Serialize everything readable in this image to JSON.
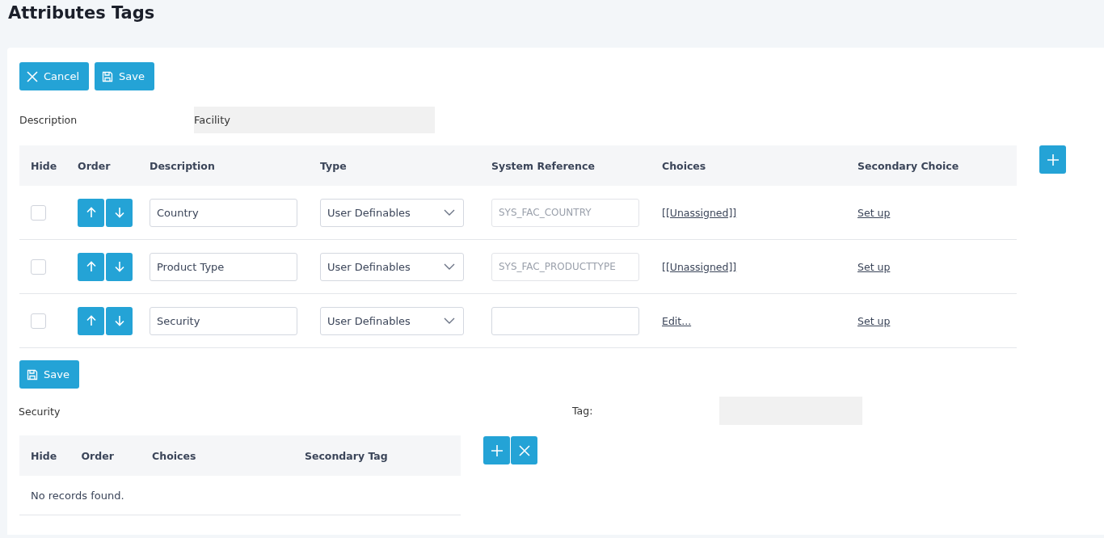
{
  "page_title": "Attributes Tags",
  "toolbar": {
    "cancel": "Cancel",
    "save": "Save"
  },
  "description": {
    "label": "Description",
    "value": "Facility"
  },
  "table": {
    "columns": [
      "Hide",
      "Order",
      "Description",
      "Type",
      "System Reference",
      "Choices",
      "Secondary Choice"
    ],
    "rows": [
      {
        "hide": false,
        "description": "Country",
        "type": "User Definables",
        "system_reference": "SYS_FAC_COUNTRY",
        "system_reference_disabled": true,
        "choices": "[[Unassigned]]",
        "secondary_choice": "Set up"
      },
      {
        "hide": false,
        "description": "Product Type",
        "type": "User Definables",
        "system_reference": "SYS_FAC_PRODUCTTYPE",
        "system_reference_disabled": true,
        "choices": "[[Unassigned]]",
        "secondary_choice": "Set up"
      },
      {
        "hide": false,
        "description": "Security",
        "type": "User Definables",
        "system_reference_disabled": false,
        "choices": "Edit...",
        "secondary_choice": "Set up"
      }
    ]
  },
  "bottom_save": "Save",
  "section_label": "Security",
  "tag": {
    "label": "Tag:"
  },
  "sub_table": {
    "columns": [
      "Hide",
      "Order",
      "Choices",
      "Secondary Tag"
    ],
    "empty_message": "No records found."
  }
}
